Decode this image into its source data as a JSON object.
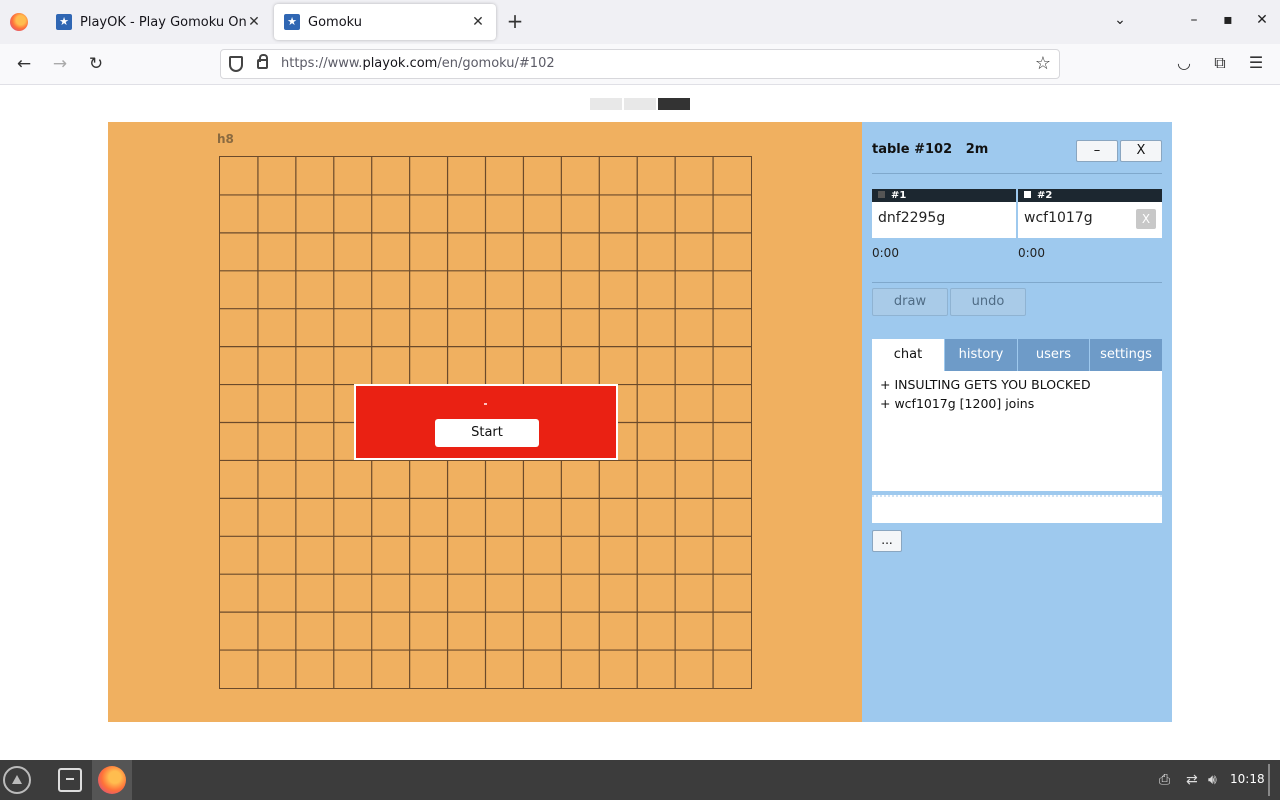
{
  "browser": {
    "tabs": [
      {
        "title": "PlayOK - Play Gomoku Online"
      },
      {
        "title": "Gomoku"
      }
    ],
    "url_prefix": "https://www.",
    "url_domain": "playok.com",
    "url_path": "/en/gomoku/#102"
  },
  "board": {
    "coordinate": "h8",
    "start_label": "Start"
  },
  "side": {
    "table_title": "table #102   2m",
    "minimize_label": "–",
    "close_label": "X",
    "players": [
      {
        "seat": "#1",
        "name": "dnf2295g",
        "time": "0:00",
        "stone": "#333333"
      },
      {
        "seat": "#2",
        "name": "wcf1017g",
        "time": "0:00",
        "stone": "#ffffff",
        "kick_label": "X"
      }
    ],
    "draw_label": "draw",
    "undo_label": "undo",
    "tabs": [
      "chat",
      "history",
      "users",
      "settings"
    ],
    "chat_lines": [
      "+ INSULTING GETS YOU BLOCKED",
      "+ wcf1017g [1200] joins"
    ],
    "more_label": "..."
  },
  "taskbar": {
    "clock": "10:18"
  }
}
